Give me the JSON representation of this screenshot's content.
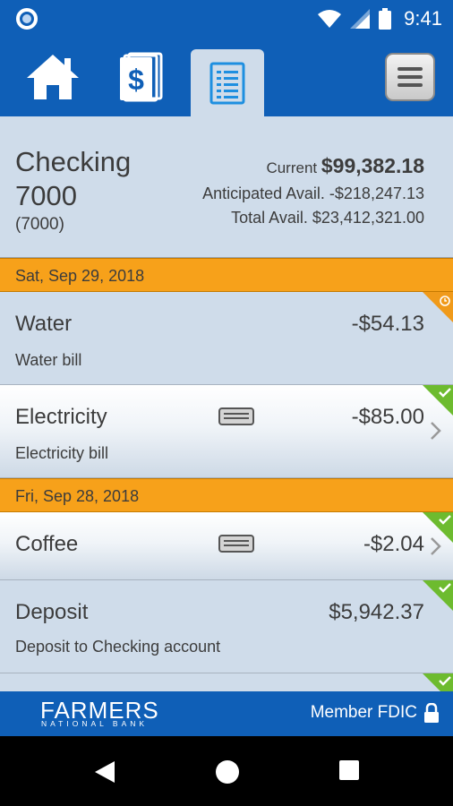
{
  "status_bar": {
    "time": "9:41",
    "icons": [
      "notification-icon",
      "wifi-icon",
      "signal-icon",
      "battery-icon"
    ]
  },
  "nav": {
    "tabs": [
      {
        "icon": "home-icon",
        "name": "Home"
      },
      {
        "icon": "accounts-dollar-icon",
        "name": "Accounts"
      },
      {
        "icon": "register-list-icon",
        "name": "Register",
        "selected": true
      }
    ],
    "menu_icon": "hamburger-menu-icon"
  },
  "account": {
    "name": "Checking 7000",
    "number": "(7000)",
    "current_label": "Current",
    "current_value": "$99,382.18",
    "anticipated_label": "Anticipated Avail.",
    "anticipated_value": "-$218,247.13",
    "total_label": "Total Avail.",
    "total_value": "$23,412,321.00"
  },
  "dates": [
    "Sat, Sep 29, 2018",
    "Fri, Sep 28, 2018"
  ],
  "transactions": [
    {
      "title": "Water",
      "desc": "Water bill",
      "amount": "-$54.13",
      "status": "pending-clock"
    },
    {
      "title": "Electricity",
      "desc": "Electricity bill",
      "amount": "-$85.00",
      "status": "cleared-check",
      "card": true
    },
    {
      "title": "Coffee",
      "desc": "",
      "amount": "-$2.04",
      "status": "cleared-check",
      "card": true
    },
    {
      "title": "Deposit",
      "desc": "Deposit to Checking account",
      "amount": "$5,942.37",
      "status": "cleared-check"
    }
  ],
  "footer": {
    "logo_main": "FARMERS",
    "logo_sub": "NATIONAL BANK",
    "fdic": "Member FDIC"
  },
  "colors": {
    "brand_blue": "#0f5fb7",
    "date_orange": "#f7a11a",
    "panel": "#cfdcea",
    "cleared_green": "#6dbb2f",
    "pending_orange": "#f09a1a"
  }
}
